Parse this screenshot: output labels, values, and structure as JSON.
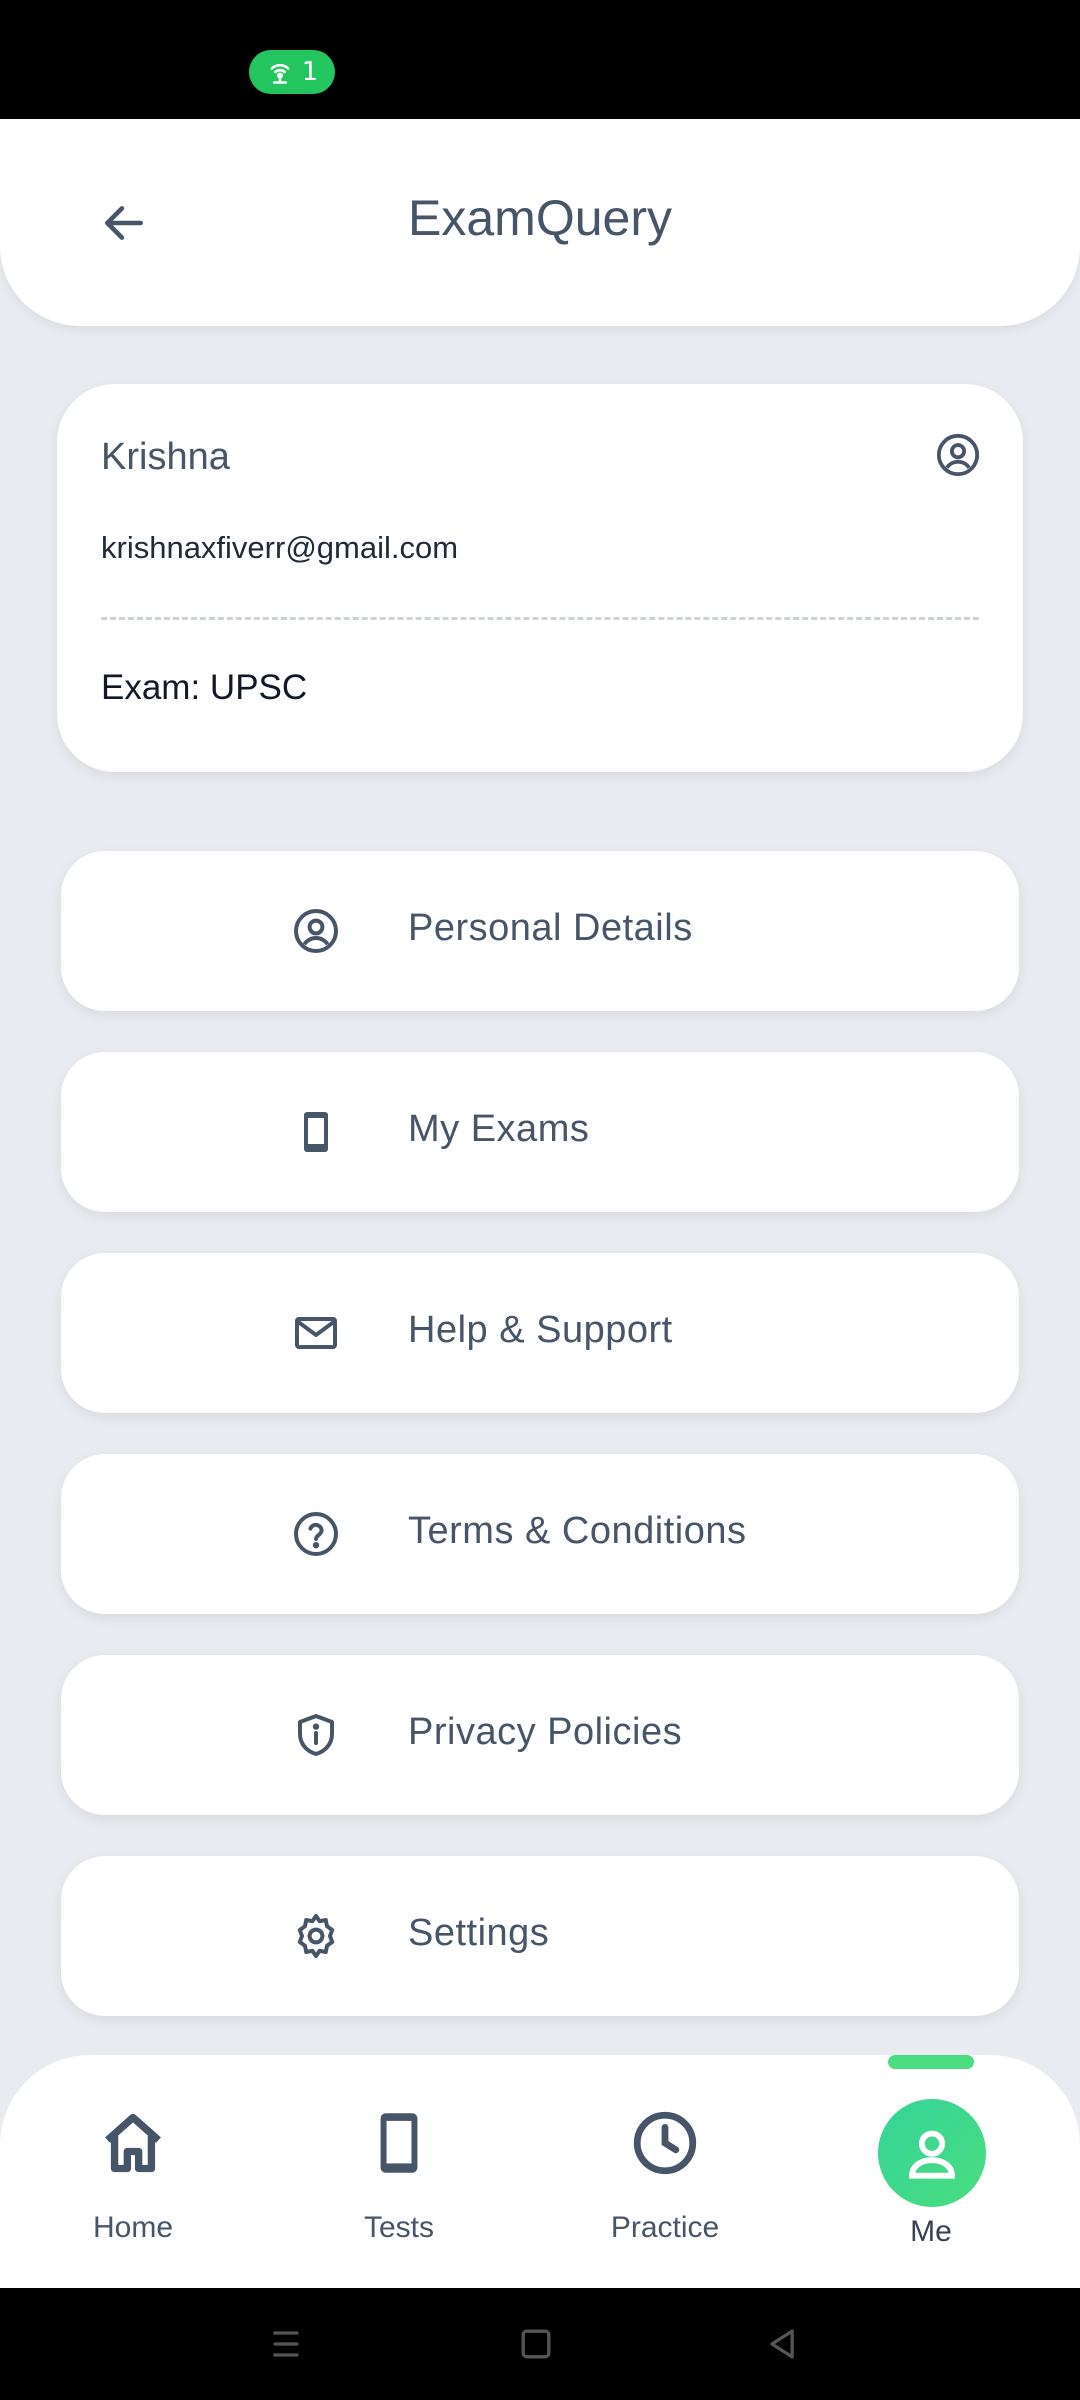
{
  "status_bar": {
    "hotspot_count": "1",
    "hotspot_color": "#22c55e"
  },
  "header": {
    "title": "ExamQuery",
    "back_icon": "arrow-left-icon"
  },
  "profile": {
    "name": "Krishna",
    "email": "krishnaxfiverr@gmail.com",
    "exam": "Exam: UPSC",
    "icon": "user-circle-icon"
  },
  "menu": {
    "items": [
      {
        "label": "Personal Details",
        "icon": "user-circle-icon"
      },
      {
        "label": "My Exams",
        "icon": "smartphone-icon"
      },
      {
        "label": "Help & Support",
        "icon": "mail-icon"
      },
      {
        "label": "Terms & Conditions",
        "icon": "help-circle-icon"
      },
      {
        "label": "Privacy Policies",
        "icon": "shield-info-icon"
      },
      {
        "label": "Settings",
        "icon": "gear-icon"
      }
    ]
  },
  "bottom_nav": {
    "accent": "#4ade80",
    "items": [
      {
        "label": "Home",
        "icon": "home-icon"
      },
      {
        "label": "Tests",
        "icon": "smartphone-icon"
      },
      {
        "label": "Practice",
        "icon": "clock-icon"
      },
      {
        "label": "Me",
        "icon": "user-icon",
        "active": true
      }
    ]
  },
  "system_nav": [
    "menu-icon",
    "home-square-icon",
    "back-triangle-icon"
  ]
}
